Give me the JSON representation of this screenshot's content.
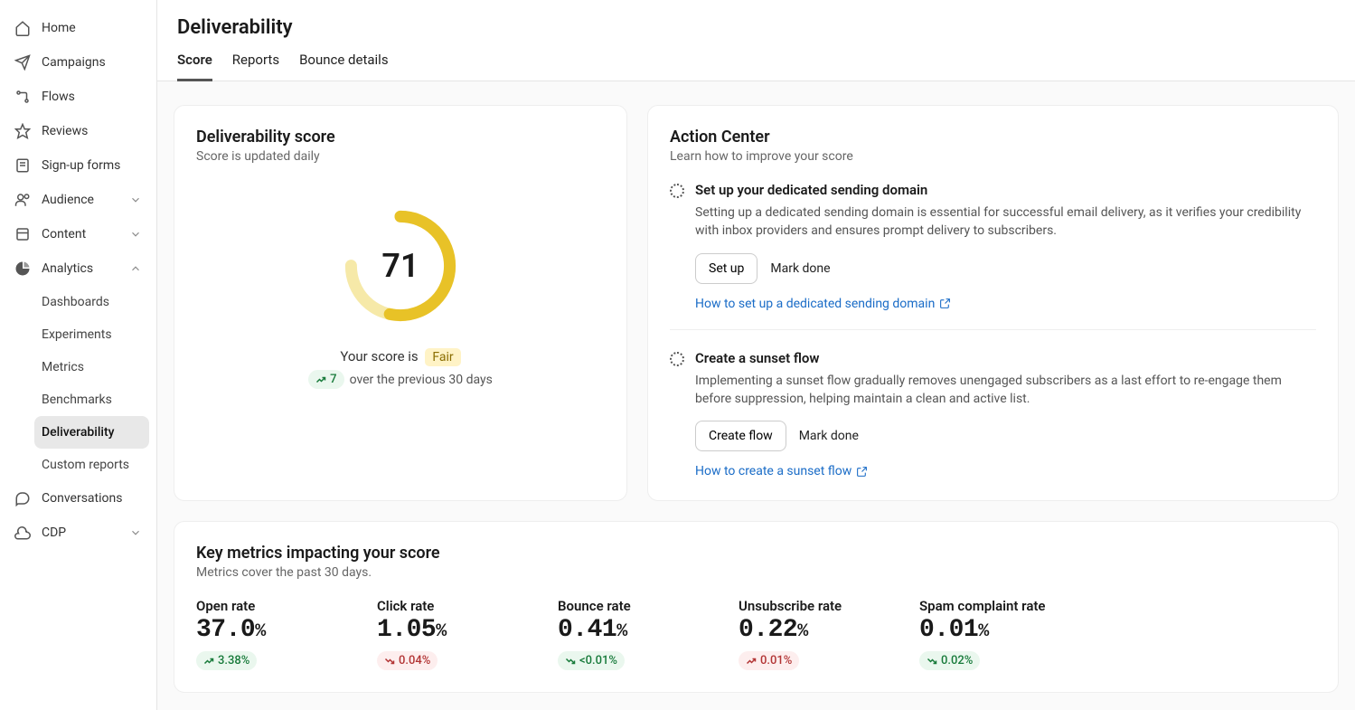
{
  "sidebar": {
    "items": [
      {
        "label": "Home"
      },
      {
        "label": "Campaigns"
      },
      {
        "label": "Flows"
      },
      {
        "label": "Reviews"
      },
      {
        "label": "Sign-up forms"
      },
      {
        "label": "Audience"
      },
      {
        "label": "Content"
      },
      {
        "label": "Analytics"
      },
      {
        "label": "Conversations"
      },
      {
        "label": "CDP"
      }
    ],
    "analyticsSub": [
      {
        "label": "Dashboards"
      },
      {
        "label": "Experiments"
      },
      {
        "label": "Metrics"
      },
      {
        "label": "Benchmarks"
      },
      {
        "label": "Deliverability"
      },
      {
        "label": "Custom reports"
      }
    ]
  },
  "page": {
    "title": "Deliverability",
    "tabs": [
      "Score",
      "Reports",
      "Bounce details"
    ]
  },
  "score": {
    "heading": "Deliverability score",
    "sub": "Score is updated daily",
    "value": "71",
    "label_prefix": "Your score is",
    "badge": "Fair",
    "trend_value": "7",
    "trend_suffix": "over the previous 30 days"
  },
  "action": {
    "heading": "Action Center",
    "sub": "Learn how to improve your score",
    "items": [
      {
        "title": "Set up your dedicated sending domain",
        "desc": "Setting up a dedicated sending domain is essential for successful email delivery, as it verifies your credibility with inbox providers and ensures prompt delivery to subscribers.",
        "primary": "Set up",
        "secondary": "Mark done",
        "help": "How to set up a dedicated sending domain"
      },
      {
        "title": "Create a sunset flow",
        "desc": "Implementing a sunset flow gradually removes unengaged subscribers as a last effort to re-engage them before suppression, helping maintain a clean and active list.",
        "primary": "Create flow",
        "secondary": "Mark done",
        "help": "How to create a sunset flow"
      }
    ]
  },
  "metrics": {
    "heading": "Key metrics impacting your score",
    "sub": "Metrics cover the past 30 days.",
    "items": [
      {
        "label": "Open rate",
        "value": "37.0",
        "unit": "%",
        "trend": "3.38%",
        "dir": "up"
      },
      {
        "label": "Click rate",
        "value": "1.05",
        "unit": "%",
        "trend": "0.04%",
        "dir": "down"
      },
      {
        "label": "Bounce rate",
        "value": "0.41",
        "unit": "%",
        "trend": "<0.01%",
        "dir": "down-good"
      },
      {
        "label": "Unsubscribe rate",
        "value": "0.22",
        "unit": "%",
        "trend": "0.01%",
        "dir": "up-bad"
      },
      {
        "label": "Spam complaint rate",
        "value": "0.01",
        "unit": "%",
        "trend": "0.02%",
        "dir": "down-good"
      }
    ]
  },
  "chart_data": {
    "type": "gauge",
    "title": "Deliverability score",
    "value": 71,
    "min": 0,
    "max": 100,
    "status_label": "Fair",
    "ring_color": "#e8c227",
    "track_color": "#f6e9a8"
  }
}
